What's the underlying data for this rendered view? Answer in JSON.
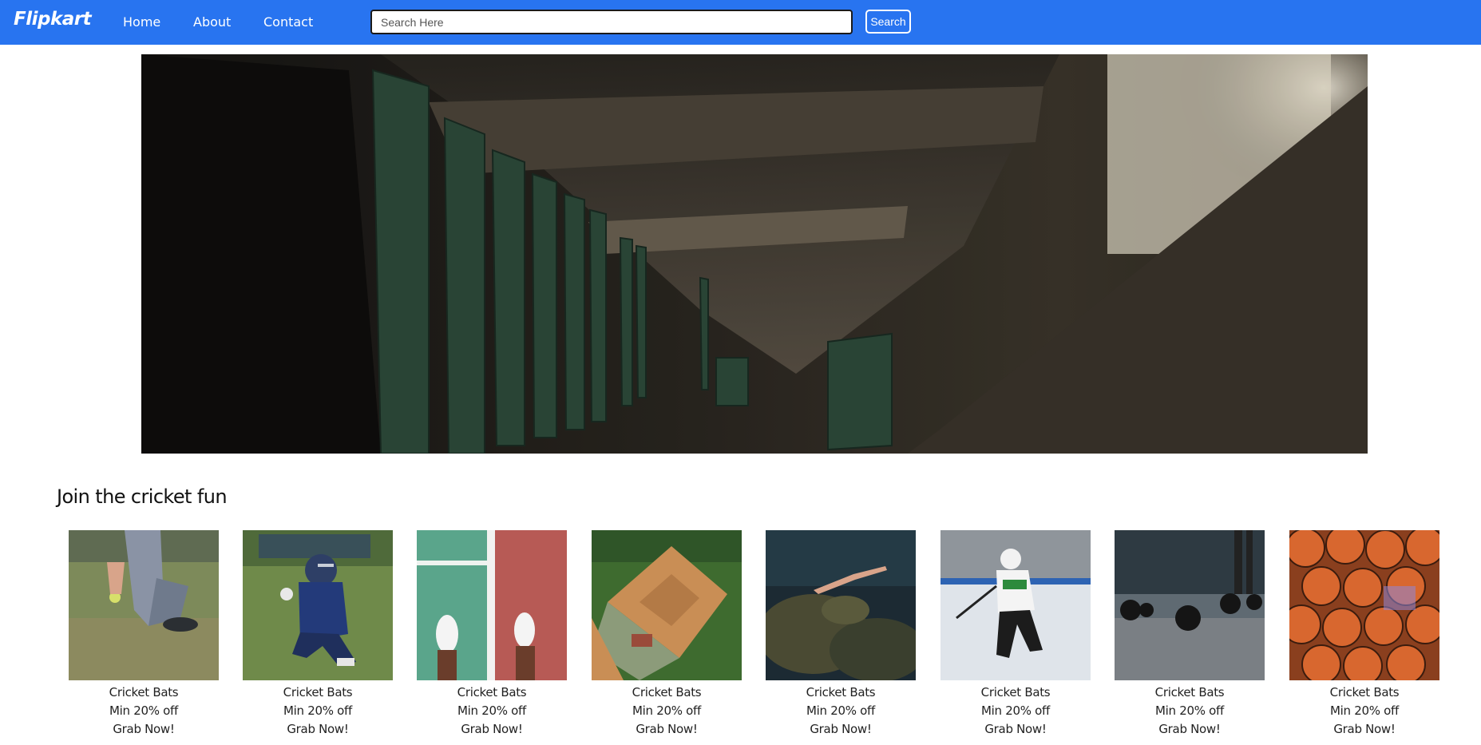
{
  "navbar": {
    "brand": "Flipkart",
    "links": [
      "Home",
      "About",
      "Contact"
    ],
    "search_placeholder": "Search Here",
    "search_value": "",
    "search_button": "Search",
    "color": "#2874f0"
  },
  "hero": {
    "image": "abandoned-locker-room-photo"
  },
  "section": {
    "title": "Join the cricket fun"
  },
  "products": [
    {
      "image": "cricket-ball-grass-photo",
      "name": "Cricket Bats",
      "offer": "Min 20% off",
      "cta": "Grab Now!"
    },
    {
      "image": "football-player-photo",
      "name": "Cricket Bats",
      "offer": "Min 20% off",
      "cta": "Grab Now!"
    },
    {
      "image": "sneakers-court-photo",
      "name": "Cricket Bats",
      "offer": "Min 20% off",
      "cta": "Grab Now!"
    },
    {
      "image": "baseball-field-aerial-photo",
      "name": "Cricket Bats",
      "offer": "Min 20% off",
      "cta": "Grab Now!"
    },
    {
      "image": "diver-underwater-photo",
      "name": "Cricket Bats",
      "offer": "Min 20% off",
      "cta": "Grab Now!"
    },
    {
      "image": "ice-hockey-player-photo",
      "name": "Cricket Bats",
      "offer": "Min 20% off",
      "cta": "Grab Now!"
    },
    {
      "image": "kettlebells-gym-photo",
      "name": "Cricket Bats",
      "offer": "Min 20% off",
      "cta": "Grab Now!"
    },
    {
      "image": "basketballs-pile-photo",
      "name": "Cricket Bats",
      "offer": "Min 20% off",
      "cta": "Grab Now!"
    }
  ]
}
